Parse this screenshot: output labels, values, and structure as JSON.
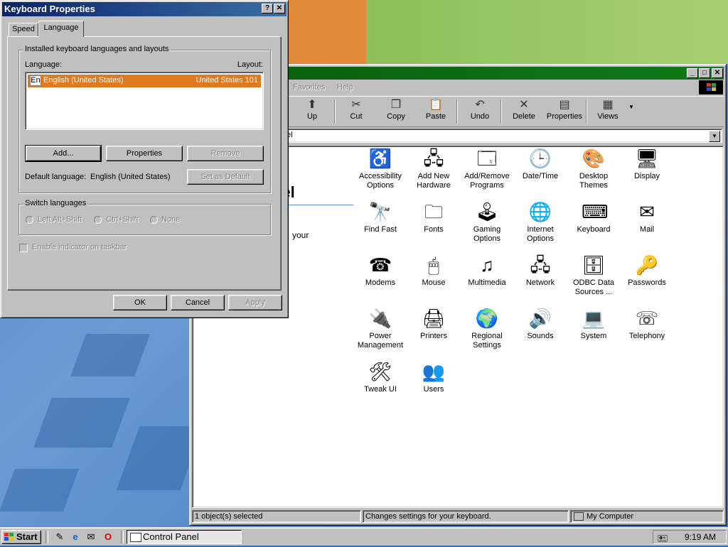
{
  "dialog": {
    "title": "Keyboard Properties",
    "help_btn": "?",
    "close_btn": "✕",
    "tabs": [
      "Speed",
      "Language"
    ],
    "group_installed": {
      "label": "Installed keyboard languages and layouts",
      "col_language": "Language:",
      "col_layout": "Layout:",
      "items": [
        {
          "badge": "En",
          "language": "English (United States)",
          "layout": "United States 101"
        }
      ],
      "add_label": "Add...",
      "properties_label": "Properties",
      "remove_label": "Remove",
      "default_lang_label": "Default language:",
      "default_lang_value": "English (United States)",
      "set_default_label": "Set as Default"
    },
    "group_switch": {
      "label": "Switch languages",
      "options": [
        "Left Alt+Shift",
        "Ctrl+Shift",
        "None"
      ]
    },
    "enable_indicator_label": "Enable indicator on taskbar",
    "ok_label": "OK",
    "cancel_label": "Cancel",
    "apply_label": "Apply"
  },
  "control_panel": {
    "menu": [
      "Favorites",
      "Help"
    ],
    "toolbar": [
      {
        "label": "Up",
        "icon": "up-folder-icon",
        "glyph": "⬆"
      },
      {
        "label": "Cut",
        "icon": "scissors-icon",
        "glyph": "✂"
      },
      {
        "label": "Copy",
        "icon": "copy-icon",
        "glyph": "❐"
      },
      {
        "label": "Paste",
        "icon": "clipboard-icon",
        "glyph": "📋"
      },
      {
        "label": "Undo",
        "icon": "undo-icon",
        "glyph": "↶"
      },
      {
        "label": "Delete",
        "icon": "delete-x-icon",
        "glyph": "✕"
      },
      {
        "label": "Properties",
        "icon": "properties-icon",
        "glyph": "▤"
      },
      {
        "label": "Views",
        "icon": "views-grid-icon",
        "glyph": "▦"
      }
    ],
    "address_text": "nel",
    "heading": "nel",
    "description": "your",
    "icons": [
      {
        "label1": "Accessibility",
        "label2": "Options",
        "icon": "accessibility-icon",
        "glyph": "♿"
      },
      {
        "label1": "Add New",
        "label2": "Hardware",
        "icon": "hardware-icon",
        "glyph": "🖧"
      },
      {
        "label1": "Add/Remove",
        "label2": "Programs",
        "icon": "programs-icon",
        "glyph": "🗔"
      },
      {
        "label1": "Date/Time",
        "label2": "",
        "icon": "clock-calendar-icon",
        "glyph": "🕒"
      },
      {
        "label1": "Desktop",
        "label2": "Themes",
        "icon": "themes-icon",
        "glyph": "🎨"
      },
      {
        "label1": "Display",
        "label2": "",
        "icon": "display-icon",
        "glyph": "🖥"
      },
      {
        "label1": "Find Fast",
        "label2": "",
        "icon": "binoculars-icon",
        "glyph": "🔭"
      },
      {
        "label1": "Fonts",
        "label2": "",
        "icon": "fonts-folder-icon",
        "glyph": "🗀"
      },
      {
        "label1": "Gaming",
        "label2": "Options",
        "icon": "joystick-icon",
        "glyph": "🕹"
      },
      {
        "label1": "Internet",
        "label2": "Options",
        "icon": "globe-icon",
        "glyph": "🌐"
      },
      {
        "label1": "Keyboard",
        "label2": "",
        "icon": "keyboard-icon",
        "glyph": "⌨"
      },
      {
        "label1": "Mail",
        "label2": "",
        "icon": "mail-icon",
        "glyph": "✉"
      },
      {
        "label1": "Modems",
        "label2": "",
        "icon": "modem-phone-icon",
        "glyph": "☎"
      },
      {
        "label1": "Mouse",
        "label2": "",
        "icon": "mouse-icon",
        "glyph": "🖱"
      },
      {
        "label1": "Multimedia",
        "label2": "",
        "icon": "multimedia-icon",
        "glyph": "♫"
      },
      {
        "label1": "Network",
        "label2": "",
        "icon": "network-icon",
        "glyph": "🖧"
      },
      {
        "label1": "ODBC Data",
        "label2": "Sources ...",
        "icon": "odbc-icon",
        "glyph": "🗄"
      },
      {
        "label1": "Passwords",
        "label2": "",
        "icon": "keys-icon",
        "glyph": "🔑"
      },
      {
        "label1": "Power",
        "label2": "Management",
        "icon": "power-plug-icon",
        "glyph": "🔌"
      },
      {
        "label1": "Printers",
        "label2": "",
        "icon": "printer-folder-icon",
        "glyph": "🖨"
      },
      {
        "label1": "Regional",
        "label2": "Settings",
        "icon": "earth-icon",
        "glyph": "🌍"
      },
      {
        "label1": "Sounds",
        "label2": "",
        "icon": "speaker-icon",
        "glyph": "🔊"
      },
      {
        "label1": "System",
        "label2": "",
        "icon": "computer-icon",
        "glyph": "💻"
      },
      {
        "label1": "Telephony",
        "label2": "",
        "icon": "telephone-icon",
        "glyph": "☏"
      },
      {
        "label1": "Tweak UI",
        "label2": "",
        "icon": "tweakui-icon",
        "glyph": "🛠"
      },
      {
        "label1": "Users",
        "label2": "",
        "icon": "users-icon",
        "glyph": "👥"
      }
    ],
    "status": {
      "selected": "1 object(s) selected",
      "hint": "Changes settings for your keyboard.",
      "zone": "My Computer"
    }
  },
  "taskbar": {
    "start_label": "Start",
    "task_label": "Control Panel",
    "time": "9:19 AM"
  }
}
